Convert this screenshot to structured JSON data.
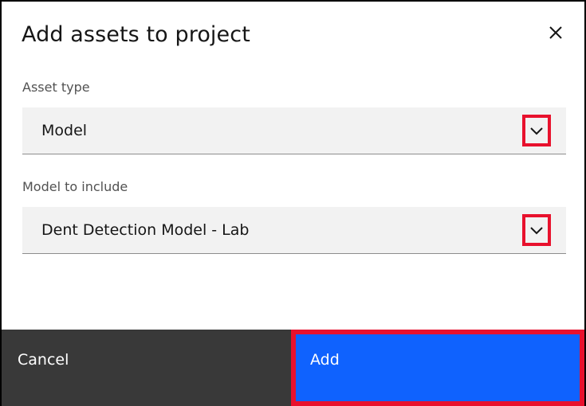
{
  "dialog": {
    "title": "Add assets to project",
    "close_icon": "close-icon"
  },
  "fields": [
    {
      "label": "Asset type",
      "value": "Model",
      "icon": "chevron-down-icon"
    },
    {
      "label": "Model to include",
      "value": "Dent Detection Model - Lab",
      "icon": "chevron-down-icon"
    }
  ],
  "footer": {
    "cancel_label": "Cancel",
    "add_label": "Add"
  },
  "colors": {
    "primary": "#0f62fe",
    "secondary": "#393939",
    "highlight": "#e8112d",
    "field_bg": "#f2f2f2"
  }
}
